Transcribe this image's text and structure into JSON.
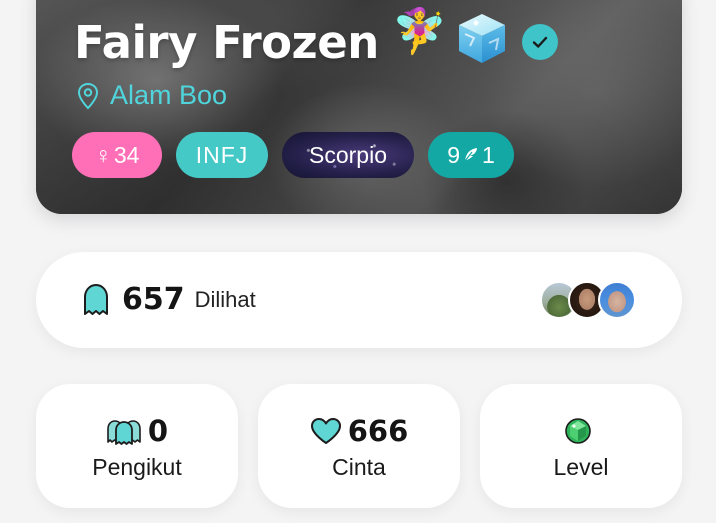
{
  "profile": {
    "name": "Fairy Frozen",
    "location": "Alam Boo",
    "emoji_fairy": "🧚‍♀️",
    "verified": true
  },
  "tags": {
    "gender_symbol": "♀",
    "age": "34",
    "mbti": "INFJ",
    "zodiac": "Scorpio",
    "wealth_level_left": "9",
    "wealth_level_right": "1"
  },
  "views": {
    "count": "657",
    "label": "Dilihat"
  },
  "stats": {
    "followers": {
      "value": "0",
      "label": "Pengikut"
    },
    "love": {
      "value": "666",
      "label": "Cinta"
    },
    "level": {
      "value": "",
      "label": "Level"
    }
  },
  "colors": {
    "accent_teal": "#3ec4c9",
    "location_teal": "#4fd5db",
    "gender_pink": "#ff6fb7",
    "mbti_teal": "#45c9c7",
    "wealth_teal": "#14a8a4",
    "level_green": "#2fb35a"
  },
  "icons": {
    "location": "location-pin-icon",
    "verified": "check-badge-icon",
    "views": "ghost-icon",
    "followers": "followers-icon",
    "love": "heart-icon",
    "level": "gem-icon",
    "wealth": "feather-icon"
  }
}
